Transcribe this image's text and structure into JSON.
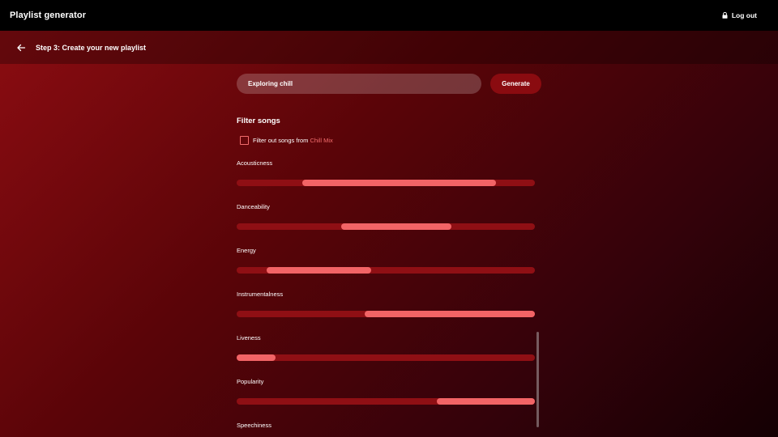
{
  "app": {
    "title": "Playlist generator",
    "logout_label": "Log out"
  },
  "step": {
    "title": "Step 3: Create your new playlist"
  },
  "playlist": {
    "name_value": "Exploring chill",
    "generate_label": "Generate"
  },
  "filters": {
    "heading": "Filter songs",
    "exclude_prefix": "Filter out songs from",
    "exclude_mix": "Chill Mix",
    "exclude_checked": false
  },
  "sliders": [
    {
      "label": "Acousticness",
      "min": 0.22,
      "max": 0.87
    },
    {
      "label": "Danceability",
      "min": 0.35,
      "max": 0.72
    },
    {
      "label": "Energy",
      "min": 0.1,
      "max": 0.45
    },
    {
      "label": "Instrumentalness",
      "min": 0.43,
      "max": 1.0
    },
    {
      "label": "Liveness",
      "min": 0.0,
      "max": 0.13
    },
    {
      "label": "Popularity",
      "min": 0.67,
      "max": 1.0
    },
    {
      "label": "Speechiness"
    }
  ],
  "colors": {
    "accent": "#f26466",
    "track": "#8f0f14",
    "button": "#8a0b10"
  },
  "icons": {
    "lock": "lock-icon",
    "back": "arrow-left-icon"
  }
}
